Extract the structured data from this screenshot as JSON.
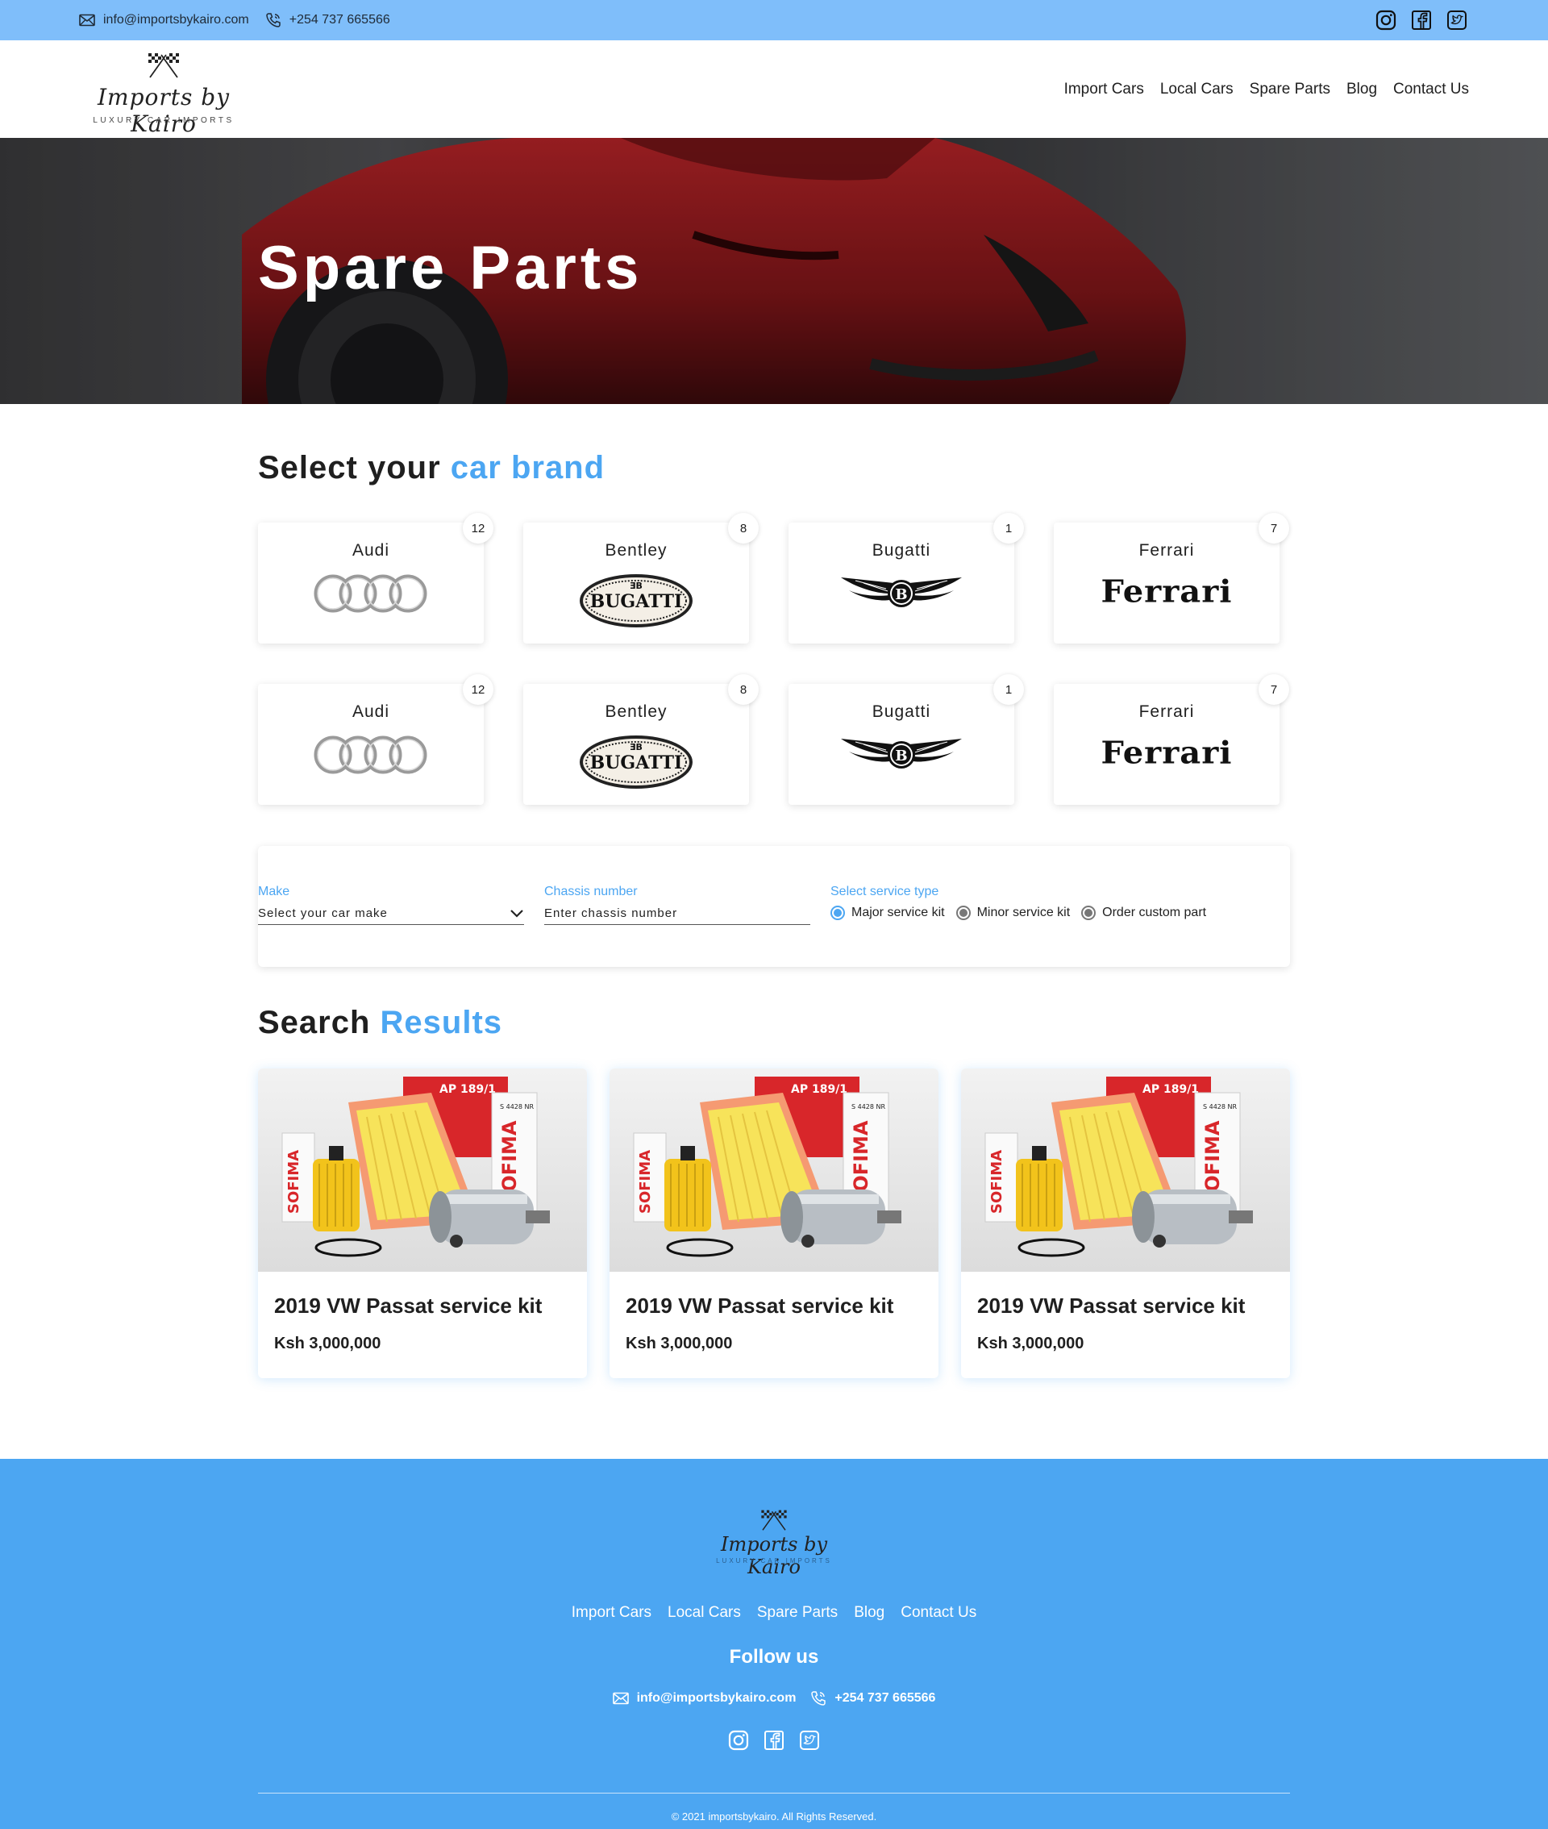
{
  "topbar": {
    "email": "info@importsbykairo.com",
    "phone": "+254 737 665566",
    "socials": [
      "instagram-icon",
      "facebook-icon",
      "twitter-icon"
    ]
  },
  "brand": {
    "logo_text": "Imports by Kairo",
    "tagline": "LUXURY CAR IMPORTS"
  },
  "nav": {
    "items": [
      "Import Cars",
      "Local Cars",
      "Spare Parts",
      "Blog",
      "Contact Us"
    ]
  },
  "hero": {
    "title": "Spare Parts"
  },
  "brands_section": {
    "title_main": "Select your ",
    "title_accent": "car brand",
    "cards": [
      {
        "name": "Audi",
        "count": "12",
        "logo": "audi-rings-icon"
      },
      {
        "name": "Bentley",
        "count": "8",
        "logo": "bugatti-badge-icon"
      },
      {
        "name": "Bugatti",
        "count": "1",
        "logo": "bentley-wings-icon"
      },
      {
        "name": "Ferrari",
        "count": "7",
        "logo": "ferrari-wordmark"
      },
      {
        "name": "Audi",
        "count": "12",
        "logo": "audi-rings-icon"
      },
      {
        "name": "Bentley",
        "count": "8",
        "logo": "bugatti-badge-icon"
      },
      {
        "name": "Bugatti",
        "count": "1",
        "logo": "bentley-wings-icon"
      },
      {
        "name": "Ferrari",
        "count": "7",
        "logo": "ferrari-wordmark"
      }
    ],
    "ferrari_word": "Ferrari",
    "bugatti_word": "BUGATTI"
  },
  "filter": {
    "make_label": "Make",
    "make_value": "Select your car make",
    "chassis_label": "Chassis number",
    "chassis_placeholder": "Enter chassis number",
    "service_label": "Select service type",
    "service_options": [
      "Major service kit",
      "Minor service kit",
      "Order custom part"
    ],
    "service_selected": "Major service kit"
  },
  "results_section": {
    "title_main": "Search ",
    "title_accent": "Results",
    "items": [
      {
        "title": "2019 VW Passat service kit",
        "price": "Ksh 3,000,000"
      },
      {
        "title": "2019 VW Passat service kit",
        "price": "Ksh 3,000,000"
      },
      {
        "title": "2019 VW Passat service kit",
        "price": "Ksh 3,000,000"
      }
    ],
    "image_labels": {
      "box_code": "AP 189/1",
      "filter_brand": "SOFIMA",
      "part_no": "S 4428 NR"
    }
  },
  "footer": {
    "nav": [
      "Import Cars",
      "Local Cars",
      "Spare Parts",
      "Blog",
      "Contact Us"
    ],
    "follow": "Follow us",
    "email": "info@importsbykairo.com",
    "phone": "+254 737 665566",
    "copyright": "© 2021 importsbykairo. All Rights Reserved."
  },
  "colors": {
    "topbar": "#7fbefa",
    "accent": "#4ca6f2",
    "footer": "#4ca6f2"
  }
}
